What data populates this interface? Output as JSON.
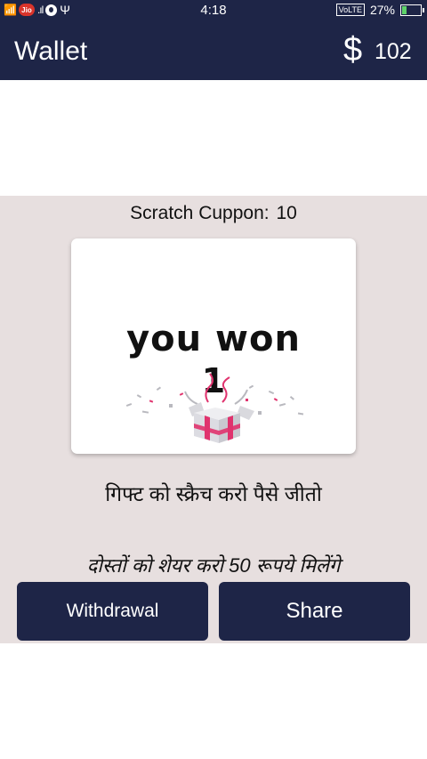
{
  "status_bar": {
    "jio_label": "Jio",
    "time": "4:18",
    "volte": "VoLTE",
    "battery_percent": "27%",
    "battery_level": 0.27,
    "icons": [
      "wifi-signal-icon",
      "jio-icon",
      "signal-bars-icon",
      "vodafone-icon",
      "usb-icon",
      "battery-charging-icon"
    ]
  },
  "app_bar": {
    "title": "Wallet",
    "currency_symbol": "$",
    "balance": "102"
  },
  "scratch": {
    "label": "Scratch Cuppon:",
    "count": "10"
  },
  "card": {
    "won_text": "you won",
    "won_amount": "1",
    "image_icon": "gift-box-icon"
  },
  "messages": {
    "scratch_hint": "गिफ्ट को स्क्रैच करो पैसे जीतो",
    "share_hint": "दोस्तों को शेयर करो 50 रूपये  मिलेंगे"
  },
  "buttons": {
    "withdraw_label": "Withdrawal",
    "share_label": "Share"
  },
  "colors": {
    "primary": "#1e2547",
    "section_bg": "#e7dfdf",
    "card_bg": "#ffffff",
    "gift_ribbon": "#e0336e"
  }
}
